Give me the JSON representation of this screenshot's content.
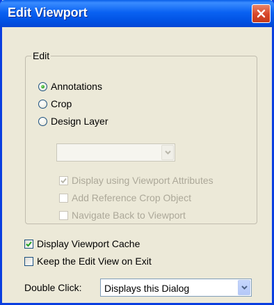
{
  "window": {
    "title": "Edit Viewport",
    "close_icon": "close-icon"
  },
  "edit_group": {
    "legend": "Edit",
    "options": [
      {
        "label": "Annotations",
        "selected": true
      },
      {
        "label": "Crop",
        "selected": false
      },
      {
        "label": "Design Layer",
        "selected": false
      }
    ],
    "layer_select": {
      "value": "",
      "enabled": false
    },
    "checkboxes": [
      {
        "label": "Display using Viewport Attributes",
        "checked": true,
        "enabled": false
      },
      {
        "label": "Add Reference Crop Object",
        "checked": false,
        "enabled": false
      },
      {
        "label": "Navigate Back to Viewport",
        "checked": false,
        "enabled": false
      }
    ]
  },
  "options": [
    {
      "label": "Display Viewport Cache",
      "checked": true
    },
    {
      "label": "Keep the Edit View on Exit",
      "checked": false
    }
  ],
  "double_click": {
    "label": "Double Click:",
    "value": "Displays this Dialog"
  },
  "colors": {
    "title_bar": "#0a62f2",
    "dialog_bg": "#ece9d8",
    "close_button": "#d8462a"
  }
}
